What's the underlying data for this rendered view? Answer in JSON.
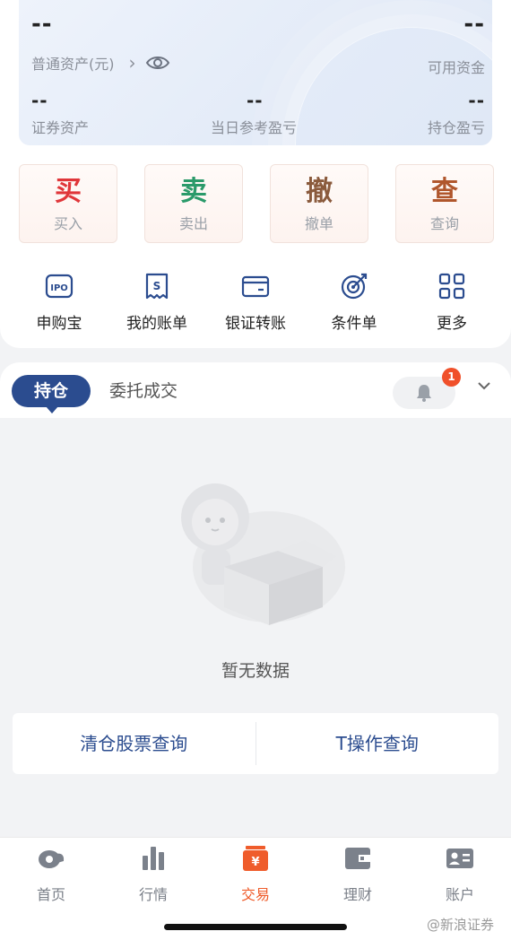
{
  "assets": {
    "total_value": "--",
    "available_value": "--",
    "total_label": "普通资产(元)",
    "available_label": "可用资金",
    "securities_value": "--",
    "securities_label": "证券资产",
    "today_pl_value": "--",
    "today_pl_label": "当日参考盈亏",
    "position_pl_value": "--",
    "position_pl_label": "持仓盈亏"
  },
  "actions": [
    {
      "big": "买",
      "sub": "买入",
      "color": "#e0363a"
    },
    {
      "big": "卖",
      "sub": "卖出",
      "color": "#2a9a6a"
    },
    {
      "big": "撤",
      "sub": "撤单",
      "color": "#8a5a3c"
    },
    {
      "big": "查",
      "sub": "查询",
      "color": "#b0562c"
    }
  ],
  "quick_menu": [
    {
      "label": "申购宝",
      "icon": "ipo-icon"
    },
    {
      "label": "我的账单",
      "icon": "bill-icon"
    },
    {
      "label": "银证转账",
      "icon": "card-icon"
    },
    {
      "label": "条件单",
      "icon": "target-icon"
    },
    {
      "label": "更多",
      "icon": "grid-icon"
    }
  ],
  "tabs": {
    "active": "持仓",
    "other": "委托成交",
    "badge_count": "1"
  },
  "empty": {
    "text": "暂无数据"
  },
  "query_buttons": [
    "清仓股票查询",
    "T操作查询"
  ],
  "bottom_nav": [
    {
      "label": "首页",
      "icon": "home-icon",
      "active": false
    },
    {
      "label": "行情",
      "icon": "market-icon",
      "active": false
    },
    {
      "label": "交易",
      "icon": "trade-icon",
      "active": true
    },
    {
      "label": "理财",
      "icon": "wallet-icon",
      "active": false
    },
    {
      "label": "账户",
      "icon": "account-icon",
      "active": false
    }
  ],
  "watermark": "@新浪证券",
  "colors": {
    "primary": "#2b4c8f",
    "accent": "#ef5c2b",
    "buy": "#e0363a",
    "sell": "#2a9a6a"
  }
}
